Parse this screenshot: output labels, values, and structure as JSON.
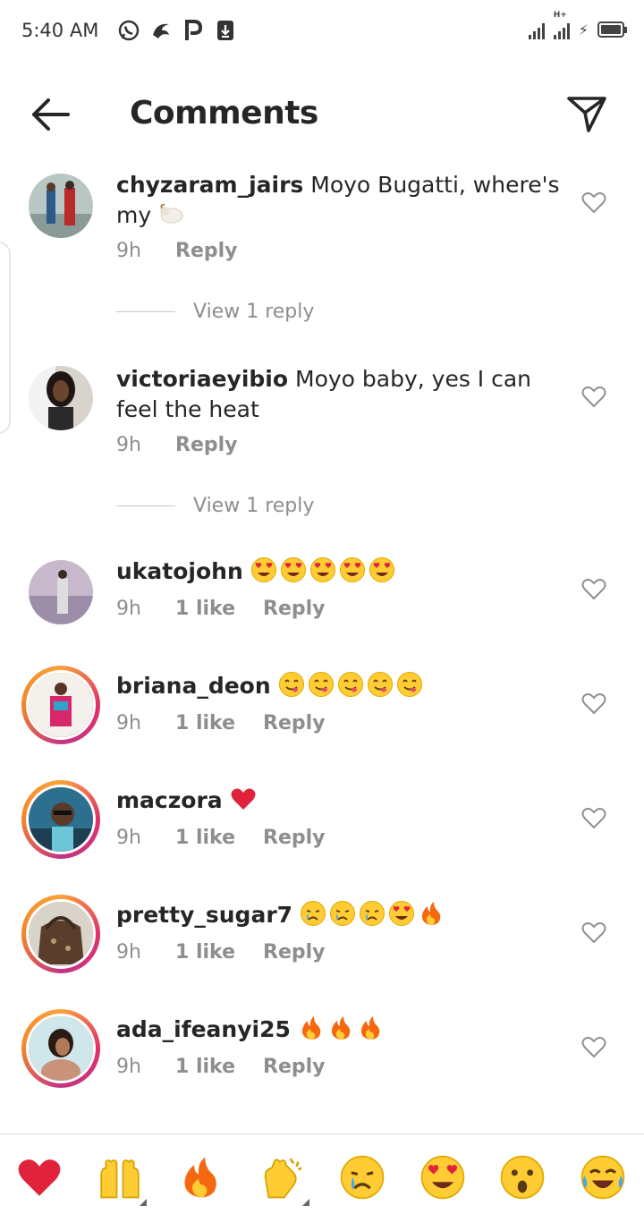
{
  "status_bar": {
    "time": "5:40 AM",
    "left_icons": [
      "whatsapp-icon",
      "app-icon",
      "p-icon",
      "download-icon"
    ],
    "network_label": "H+"
  },
  "header": {
    "title": "Comments",
    "back_icon": "arrow-left-icon",
    "share_icon": "send-icon"
  },
  "comments": [
    {
      "username": "chyzaram_jairs",
      "text": "Moyo Bugatti,  where's my",
      "trailing_emoji": [
        "ram"
      ],
      "time": "9h",
      "likes": "",
      "reply_label": "Reply",
      "view_replies": "View 1 reply"
    },
    {
      "username": "victoriaeyibio",
      "text": "Moyo baby, yes I can feel the heat",
      "trailing_emoji": [],
      "time": "9h",
      "likes": "",
      "reply_label": "Reply",
      "view_replies": "View 1 reply"
    },
    {
      "username": "ukatojohn",
      "text": "",
      "trailing_emoji": [
        "heart-eyes",
        "heart-eyes",
        "heart-eyes",
        "heart-eyes",
        "heart-eyes"
      ],
      "time": "9h",
      "likes": "1 like",
      "reply_label": "Reply"
    },
    {
      "username": "briana_deon",
      "text": "",
      "trailing_emoji": [
        "yum",
        "yum",
        "yum",
        "yum",
        "yum"
      ],
      "time": "9h",
      "likes": "1 like",
      "reply_label": "Reply"
    },
    {
      "username": "maczora",
      "text": "",
      "trailing_emoji": [
        "red-heart"
      ],
      "time": "9h",
      "likes": "1 like",
      "reply_label": "Reply"
    },
    {
      "username": "pretty_sugar7",
      "text": "",
      "trailing_emoji": [
        "crying",
        "crying",
        "crying",
        "heart-eyes",
        "fire"
      ],
      "time": "9h",
      "likes": "1 like",
      "reply_label": "Reply"
    },
    {
      "username": "ada_ifeanyi25",
      "text": "",
      "trailing_emoji": [
        "fire",
        "fire",
        "fire"
      ],
      "time": "9h",
      "likes": "1 like",
      "reply_label": "Reply"
    }
  ],
  "emoji_bar": [
    "red-heart",
    "raising-hands",
    "fire",
    "clapping-hands",
    "crying",
    "heart-eyes",
    "surprised",
    "tears-of-joy"
  ],
  "colors": {
    "text": "#262626",
    "muted": "#8e8e8e",
    "heart": "#e0233a",
    "emoji_yellow": "#ffcc33"
  }
}
